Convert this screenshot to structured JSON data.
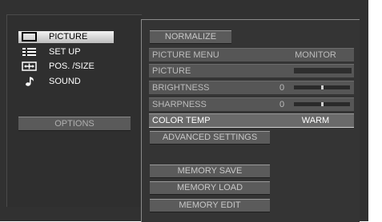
{
  "sidebar": {
    "items": [
      {
        "label": "PICTURE",
        "icon": "monitor-icon",
        "active": true
      },
      {
        "label": "SET UP",
        "icon": "list-icon",
        "active": false
      },
      {
        "label": "POS. /SIZE",
        "icon": "position-icon",
        "active": false
      },
      {
        "label": "SOUND",
        "icon": "music-note-icon",
        "active": false
      }
    ],
    "options_label": "OPTIONS"
  },
  "picture": {
    "normalize_label": "NORMALIZE",
    "picture_menu": {
      "label": "PICTURE MENU",
      "value": "MONITOR"
    },
    "picture": {
      "label": "PICTURE"
    },
    "brightness": {
      "label": "BRIGHTNESS",
      "value": "0",
      "level": 0.5
    },
    "sharpness": {
      "label": "SHARPNESS",
      "value": "0",
      "level": 0.5
    },
    "color_temp": {
      "label": "COLOR TEMP",
      "value": "WARM"
    },
    "advanced_label": "ADVANCED SETTINGS",
    "memory_save_label": "MEMORY SAVE",
    "memory_load_label": "MEMORY LOAD",
    "memory_edit_label": "MEMORY EDIT"
  },
  "colors": {
    "background": "#313131",
    "active_item": "#e0e0e0",
    "row": "#565656",
    "highlight_row": "#6a6a6a"
  }
}
